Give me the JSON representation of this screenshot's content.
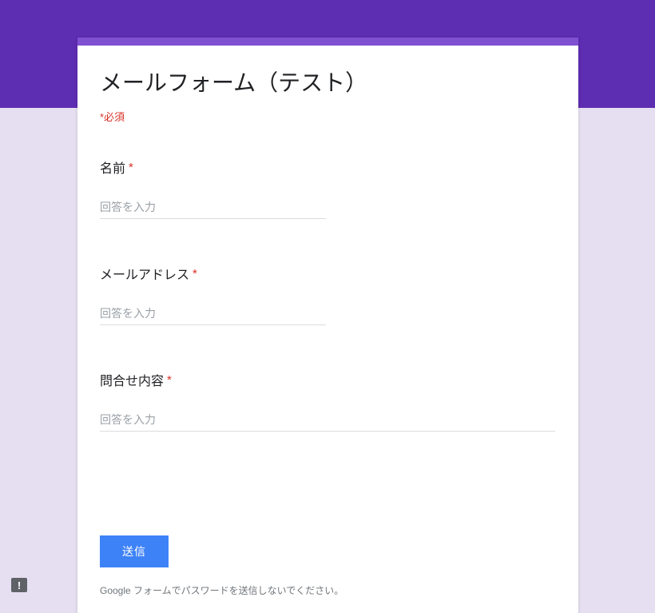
{
  "form": {
    "title": "メールフォーム（テスト）",
    "required_note": "*必須",
    "fields": [
      {
        "label": "名前",
        "placeholder": "回答を入力",
        "value": "",
        "wide": false
      },
      {
        "label": "メールアドレス",
        "placeholder": "回答を入力",
        "value": "",
        "wide": false
      },
      {
        "label": "問合せ内容",
        "placeholder": "回答を入力",
        "value": "",
        "wide": true
      }
    ],
    "asterisk": "*",
    "submit_label": "送信",
    "footer_note": "Google フォームでパスワードを送信しないでください。"
  }
}
